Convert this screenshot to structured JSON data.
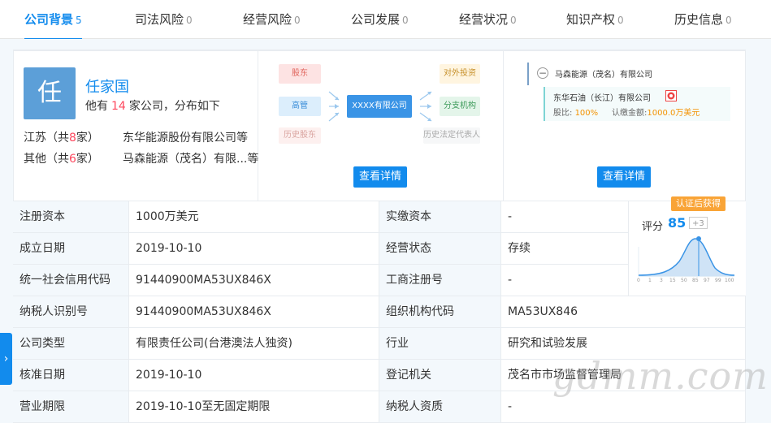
{
  "tabs": [
    {
      "label": "公司背景",
      "count": "5"
    },
    {
      "label": "司法风险",
      "count": "0"
    },
    {
      "label": "经营风险",
      "count": "0"
    },
    {
      "label": "公司发展",
      "count": "0"
    },
    {
      "label": "经营状况",
      "count": "0"
    },
    {
      "label": "知识产权",
      "count": "0"
    },
    {
      "label": "历史信息",
      "count": "0"
    }
  ],
  "person": {
    "avatar_char": "任",
    "name": "任家国",
    "sub_prefix": "他有",
    "company_count": "14",
    "sub_suffix": "家公司，分布如下",
    "regions": [
      {
        "prefix": "江苏（共",
        "count": "8",
        "suffix": "家）",
        "company": "东华能源股份有限公司等"
      },
      {
        "prefix": "其他（共",
        "count": "6",
        "suffix": "家）",
        "company": "马森能源（茂名）有限...等"
      }
    ]
  },
  "structure_diagram": {
    "left": [
      "股东",
      "高管",
      "历史股东"
    ],
    "center": "XXXX有限公司",
    "right": [
      "对外投资",
      "分支机构",
      "历史法定代表人"
    ],
    "button": "查看详情"
  },
  "equity_diagram": {
    "root_company": "马森能源（茂名）有限公司",
    "toggle_symbol": "−",
    "child_company": "东华石油（长江）有限公司",
    "share_label": "股比:",
    "share_value": "100%",
    "subscribed_label": "认缴金额:",
    "subscribed_value": "1000.0万美元",
    "button": "查看详情"
  },
  "score": {
    "badge": "认证后获得",
    "label": "评分",
    "value": "85",
    "delta": "+3",
    "axis_ticks": [
      "0",
      "1",
      "3",
      "15",
      "50",
      "85",
      "97",
      "99",
      "100"
    ]
  },
  "info_table": {
    "rows": [
      {
        "l1": "注册资本",
        "v1": "1000万美元",
        "l2": "实缴资本",
        "v2": "-"
      },
      {
        "l1": "成立日期",
        "v1": "2019-10-10",
        "l2": "经营状态",
        "v2": "存续"
      },
      {
        "l1": "统一社会信用代码",
        "v1": "91440900MA53UX846X",
        "l2": "工商注册号",
        "v2": "-"
      },
      {
        "l1": "纳税人识别号",
        "v1": "91440900MA53UX846X",
        "l2": "组织机构代码",
        "v2": "MA53UX846"
      },
      {
        "l1": "公司类型",
        "v1": "有限责任公司(台港澳法人独资)",
        "l2": "行业",
        "v2": "研究和试验发展"
      },
      {
        "l1": "核准日期",
        "v1": "2019-10-10",
        "l2": "登记机关",
        "v2": "茂名市市场监督管理局"
      },
      {
        "l1": "营业期限",
        "v1": "2019-10-10至无固定期限",
        "l2": "纳税人资质",
        "v2": "-"
      }
    ]
  },
  "side_tab_symbol": "›",
  "watermark": "gdmm.com",
  "colors": {
    "accent": "#128bed",
    "highlight": "#fd485e",
    "avatar": "#5c9fd8",
    "label_bg": "#f3f8fc"
  }
}
